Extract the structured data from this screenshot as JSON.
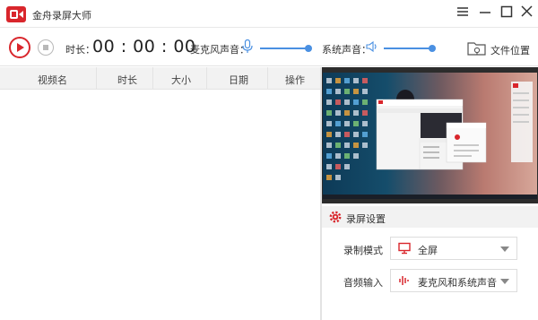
{
  "window": {
    "title": "金舟录屏大师"
  },
  "toolbar": {
    "duration_label": "时长：",
    "duration_value": "00 : 00 : 00",
    "mic_label": "麦克风声音：",
    "mic_volume": 1.0,
    "system_label": "系统声音：",
    "system_volume": 1.0,
    "file_location_label": "文件位置"
  },
  "table": {
    "columns": [
      "视频名",
      "时长",
      "大小",
      "日期",
      "操作"
    ],
    "rows": []
  },
  "settings": {
    "title": "录屏设置",
    "record_mode_label": "录制模式",
    "record_mode_value": "全屏",
    "audio_input_label": "音频输入",
    "audio_input_value": "麦克风和系统声音"
  },
  "colors": {
    "accent": "#d9262c",
    "slider": "#4a90e2"
  }
}
